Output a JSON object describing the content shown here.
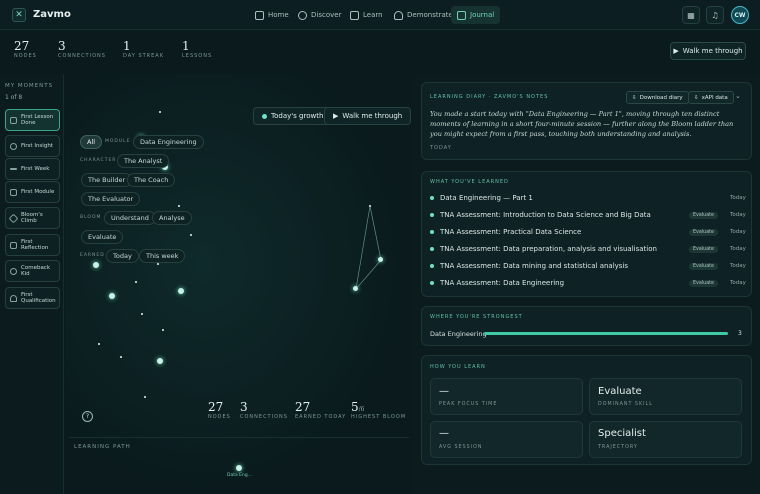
{
  "app": {
    "brand": "Zavmo",
    "avatar_initials": "CW"
  },
  "nav": {
    "items": [
      {
        "label": "Home",
        "icon": "home-icon"
      },
      {
        "label": "Discover",
        "icon": "compass-icon"
      },
      {
        "label": "Learn",
        "icon": "book-icon"
      },
      {
        "label": "Demonstrate",
        "icon": "award-icon"
      },
      {
        "label": "Journal",
        "icon": "journal-icon"
      }
    ],
    "active": "Journal"
  },
  "stats": [
    {
      "value": "27",
      "label": "NODES"
    },
    {
      "value": "3",
      "label": "CONNECTIONS"
    },
    {
      "value": "1",
      "label": "DAY STREAK"
    },
    {
      "value": "1",
      "label": "LESSONS"
    }
  ],
  "walk_label": "Walk me through",
  "moments": {
    "title": "MY MOMENTS",
    "count": "1 of 8",
    "items": [
      "First Lesson Done",
      "First Insight",
      "First Week",
      "First Module",
      "Bloom's Climb",
      "First Reflection",
      "Comeback Kid",
      "First Qualification"
    ]
  },
  "filters": {
    "all": "All",
    "module_label": "MODULE",
    "module": "Data Engineering",
    "character_label": "CHARACTER",
    "characters": [
      "The Analyst",
      "The Builder",
      "The Coach",
      "The Evaluator"
    ],
    "bloom_label": "BLOOM",
    "bloom": [
      "Understand",
      "Analyse",
      "Evaluate"
    ],
    "earned_label": "EARNED",
    "earned": [
      "Today",
      "This week"
    ]
  },
  "graph": {
    "growth_label": "Today's growth",
    "walk_label": "Walk me through",
    "help_glyph": "?",
    "stats": [
      {
        "value": "27",
        "label": "NODES"
      },
      {
        "value": "3",
        "label": "CONNECTIONS"
      },
      {
        "value": "27",
        "label": "EARNED TODAY"
      },
      {
        "value": "5",
        "suffix": "/6",
        "label": "HIGHEST BLOOM"
      }
    ],
    "path_label": "LEARNING PATH",
    "path_node": "Data Eng..."
  },
  "diary": {
    "title": "LEARNING DIARY · ZAVMO'S NOTES",
    "download": "Download diary",
    "xapi": "xAPI data",
    "text": "You made a start today with \"Data Engineering — Part 1\", moving through ten distinct moments of learning in a short four-minute session — further along the Bloom ladder than you might expect from a first pass, touching both understanding and analysis.",
    "when": "TODAY"
  },
  "learned": {
    "title": "WHAT YOU'VE LEARNED",
    "items": [
      {
        "text": "Data Engineering — Part 1",
        "badge": "",
        "when": "Today"
      },
      {
        "text": "TNA Assessment: Introduction to Data Science and Big Data",
        "badge": "Evaluate",
        "when": "Today"
      },
      {
        "text": "TNA Assessment: Practical Data Science",
        "badge": "Evaluate",
        "when": "Today"
      },
      {
        "text": "TNA Assessment: Data preparation, analysis and visualisation",
        "badge": "Evaluate",
        "when": "Today"
      },
      {
        "text": "TNA Assessment: Data mining and statistical analysis",
        "badge": "Evaluate",
        "when": "Today"
      },
      {
        "text": "TNA Assessment: Data Engineering",
        "badge": "Evaluate",
        "when": "Today"
      }
    ]
  },
  "strongest": {
    "title": "WHERE YOU'RE STRONGEST",
    "skill": "Data Engineering",
    "value": "3",
    "fill": 1.0
  },
  "how": {
    "title": "HOW YOU LEARN",
    "cards": [
      {
        "value": "—",
        "label": "PEAK FOCUS TIME"
      },
      {
        "value": "Evaluate",
        "label": "DOMINANT SKILL"
      },
      {
        "value": "—",
        "label": "AVG SESSION"
      },
      {
        "value": "Specialist",
        "label": "TRAJECTORY"
      }
    ]
  },
  "colors": {
    "accent": "#6fd2b8",
    "bg": "#0a1a1d",
    "bar": "#3fc9a5"
  }
}
